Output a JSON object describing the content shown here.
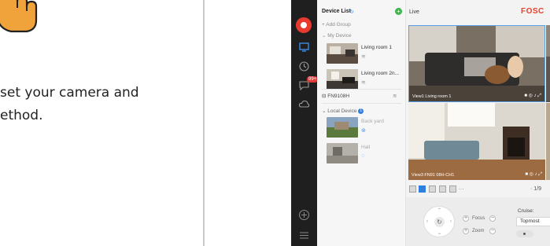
{
  "instructions": {
    "line1": "set your camera and",
    "line2": "ethod."
  },
  "sidebar": {
    "badge": "99+",
    "icons": [
      "camera-logo-icon",
      "live-view-icon",
      "playback-icon",
      "message-icon",
      "cloud-icon",
      "add-icon",
      "menu-icon"
    ]
  },
  "device_list": {
    "title": "Device List",
    "add_group": "+ Add Group",
    "my_device": "My Device",
    "devices": [
      {
        "name": "Living room 1",
        "online": true
      },
      {
        "name": "Living room 2n...",
        "online": true
      }
    ],
    "nvr": "FN9108H",
    "local_device": "Local Device",
    "local_count": "1",
    "local_devices": [
      {
        "name": "Back yard",
        "online": false
      },
      {
        "name": "Hall",
        "online": false
      }
    ]
  },
  "main": {
    "title": "Live",
    "brand": "FOSC",
    "views": [
      {
        "label": "View1 Living room 1"
      },
      {
        "label": "View3 FN91 08H-CH1"
      }
    ],
    "pager": "1/9"
  },
  "ptz": {
    "focus_label": "Focus",
    "zoom_label": "Zoom",
    "cruise_label": "Cruise:",
    "cruise_value": "Topmost"
  },
  "colors": {
    "accent": "#2f7fe0",
    "brand": "#e8402a",
    "hand": "#f0a23b",
    "rail": "#1f1f1f",
    "online": "#3cb54a"
  }
}
